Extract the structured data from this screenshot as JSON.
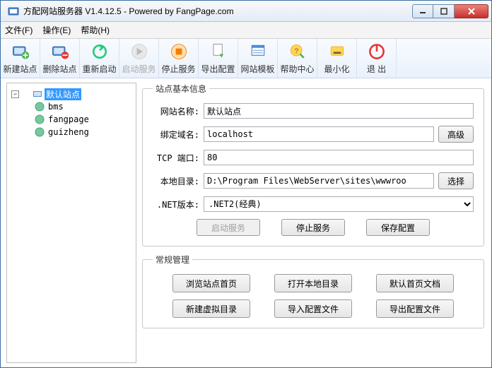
{
  "window": {
    "title": "方配网站服务器 V1.4.12.5 - Powered by FangPage.com"
  },
  "menu": {
    "file": "文件(F)",
    "operate": "操作(E)",
    "help": "帮助(H)"
  },
  "toolbar": {
    "new_site": "新建站点",
    "delete_site": "删除站点",
    "restart": "重新启动",
    "start_service": "启动服务",
    "stop_service": "停止服务",
    "export_config": "导出配置",
    "site_template": "网站模板",
    "help_center": "帮助中心",
    "minimize": "最小化",
    "exit": "退 出"
  },
  "tree": {
    "root": "默认站点",
    "children": [
      "bms",
      "fangpage",
      "guizheng"
    ]
  },
  "basic": {
    "legend": "站点基本信息",
    "name_label": "网站名称:",
    "name_value": "默认站点",
    "domain_label": "绑定域名:",
    "domain_value": "localhost",
    "advanced": "高级",
    "port_label": "TCP 端口:",
    "port_value": "80",
    "localdir_label": "本地目录:",
    "localdir_value": "D:\\Program Files\\WebServer\\sites\\wwwroo",
    "select": "选择",
    "netver_label": ".NET版本:",
    "netver_value": ".NET2(经典)",
    "start_service_btn": "启动服务",
    "stop_service_btn": "停止服务",
    "save_config_btn": "保存配置"
  },
  "manage": {
    "legend": "常规管理",
    "browse_home": "浏览站点首页",
    "open_localdir": "打开本地目录",
    "default_home_doc": "默认首页文档",
    "new_vdir": "新建虚拟目录",
    "import_config": "导入配置文件",
    "export_config": "导出配置文件"
  }
}
